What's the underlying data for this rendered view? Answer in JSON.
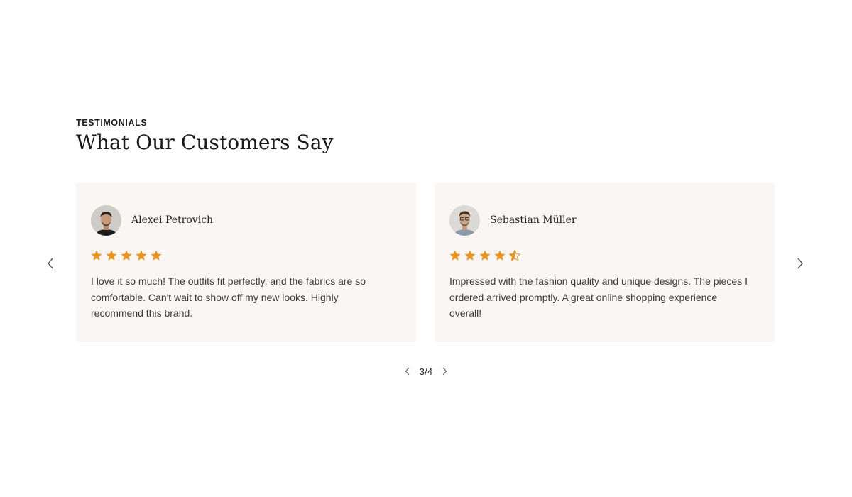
{
  "section": {
    "eyebrow": "TESTIMONIALS",
    "heading": "What Our Customers Say"
  },
  "testimonials": [
    {
      "name": "Alexei Petrovich",
      "rating": 5,
      "quote": "I love it so much! The outfits fit perfectly, and the fabrics are so comfortable. Can't wait to show off my new looks. Highly recommend this brand.",
      "avatar_icon": "person-avatar-icon"
    },
    {
      "name": "Sebastian Müller",
      "rating": 4.5,
      "quote": "Impressed with the fashion quality and unique designs. The pieces I ordered arrived promptly. A great online shopping experience overall!",
      "avatar_icon": "person-avatar-icon"
    }
  ],
  "pagination": {
    "current": 3,
    "total": 4,
    "label": "3/4"
  },
  "colors": {
    "card_background": "#f9f6f3",
    "star": "#e8941f",
    "heading": "#1a1a1a"
  },
  "icons": {
    "prev": "chevron-left-icon",
    "next": "chevron-right-icon",
    "star": "star-icon"
  }
}
